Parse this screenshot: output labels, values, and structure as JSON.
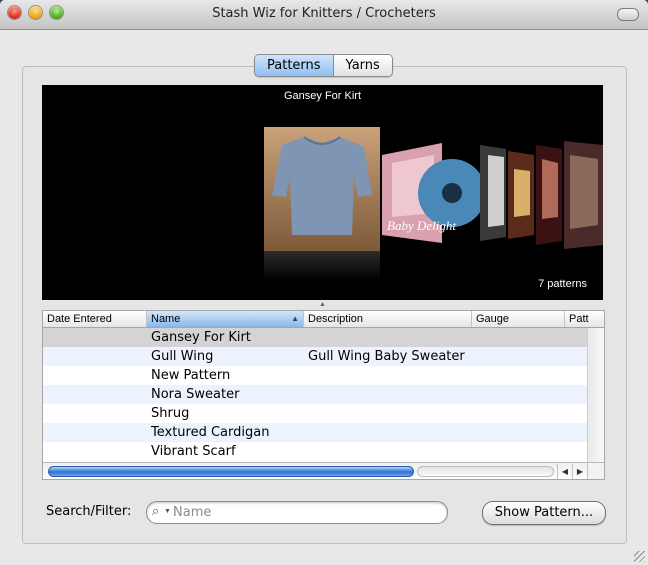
{
  "window": {
    "title": "Stash Wiz for Knitters / Crocheters"
  },
  "tabs": [
    {
      "label": "Patterns",
      "selected": true
    },
    {
      "label": "Yarns",
      "selected": false
    }
  ],
  "coverflow": {
    "current_title": "Gansey For Kirt",
    "count_text": "7 patterns",
    "cover_text": "Baby Delight"
  },
  "table": {
    "columns": [
      "Date Entered",
      "Name",
      "Description",
      "Gauge",
      "Patt"
    ],
    "sorted_column": "Name",
    "rows": [
      {
        "name": "Gansey For Kirt",
        "description": "",
        "selected": true
      },
      {
        "name": "Gull Wing",
        "description": "Gull Wing Baby Sweater"
      },
      {
        "name": "New Pattern",
        "description": ""
      },
      {
        "name": "Nora Sweater",
        "description": ""
      },
      {
        "name": "Shrug",
        "description": ""
      },
      {
        "name": "Textured Cardigan",
        "description": ""
      },
      {
        "name": "Vibrant Scarf",
        "description": ""
      }
    ]
  },
  "search": {
    "label": "Search/Filter:",
    "placeholder": "Name",
    "value": ""
  },
  "show_button": {
    "label": "Show Pattern..."
  },
  "colors": {
    "accent": "#3f7fd8",
    "coverflow_bg": "#000000"
  },
  "icons": {
    "search": "magnifier-icon",
    "sort": "sort-ascending-icon"
  }
}
